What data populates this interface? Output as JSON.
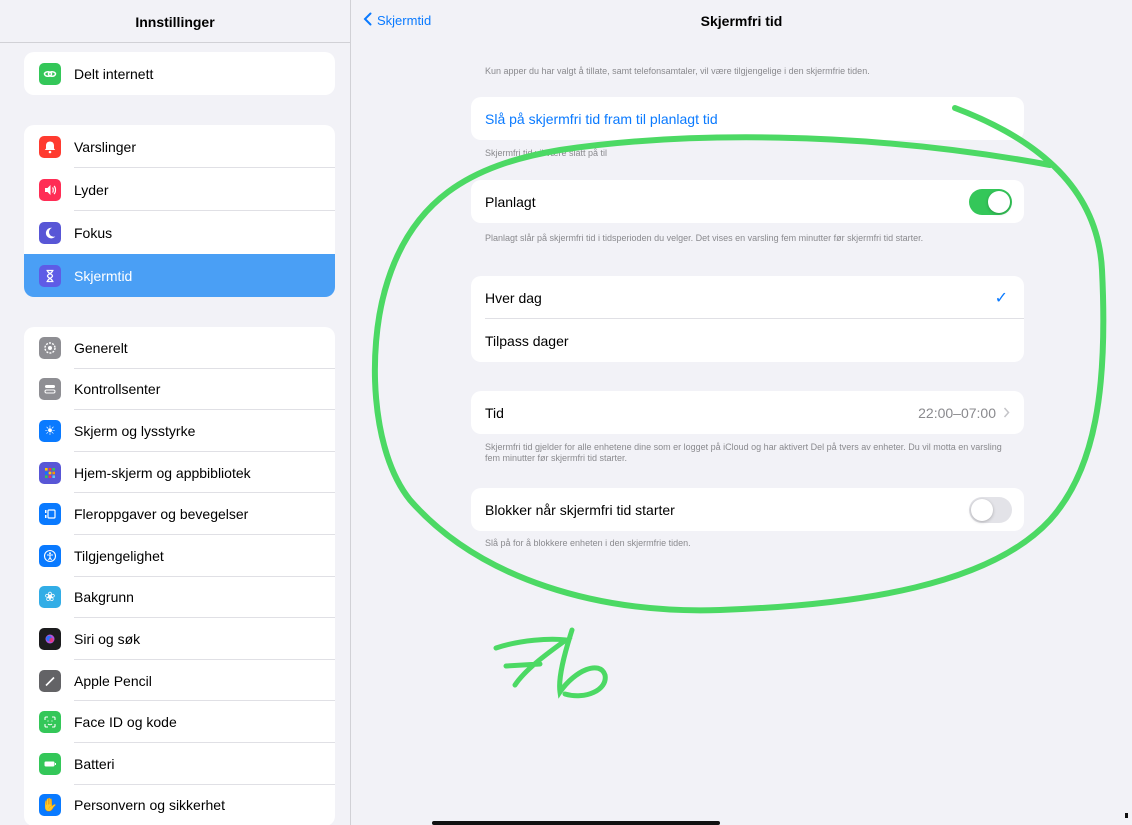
{
  "sidebar": {
    "title": "Innstillinger",
    "group1": [
      {
        "label": "Delt internett",
        "icon": "link-icon",
        "color": "#34c759"
      }
    ],
    "group2": [
      {
        "label": "Varslinger",
        "icon": "bell-icon",
        "color": "#ff3b30"
      },
      {
        "label": "Lyder",
        "icon": "speaker-icon",
        "color": "#ff2d55"
      },
      {
        "label": "Fokus",
        "icon": "moon-icon",
        "color": "#5856d6"
      },
      {
        "label": "Skjermtid",
        "icon": "hourglass-icon",
        "color": "#5e5ce6",
        "selected": true
      }
    ],
    "group3": [
      {
        "label": "Generelt",
        "icon": "gear-icon",
        "color": "#8e8e93"
      },
      {
        "label": "Kontrollsenter",
        "icon": "switches-icon",
        "color": "#8e8e93"
      },
      {
        "label": "Skjerm og lysstyrke",
        "icon": "sun-icon",
        "color": "#0a7aff"
      },
      {
        "label": "Hjem-skjerm og appbibliotek",
        "icon": "grid-icon",
        "color": "#5856d6"
      },
      {
        "label": "Fleroppgaver og bevegelser",
        "icon": "multitask-icon",
        "color": "#0a7aff"
      },
      {
        "label": "Tilgjengelighet",
        "icon": "accessibility-icon",
        "color": "#0a7aff"
      },
      {
        "label": "Bakgrunn",
        "icon": "flower-icon",
        "color": "#32ade6"
      },
      {
        "label": "Siri og søk",
        "icon": "siri-icon",
        "color": "#1c1c1e"
      },
      {
        "label": "Apple Pencil",
        "icon": "pencil-icon",
        "color": "#636366"
      },
      {
        "label": "Face ID og kode",
        "icon": "faceid-icon",
        "color": "#34c759"
      },
      {
        "label": "Batteri",
        "icon": "battery-icon",
        "color": "#34c759"
      },
      {
        "label": "Personvern og sikkerhet",
        "icon": "hand-icon",
        "color": "#0a7aff"
      }
    ]
  },
  "detail": {
    "back_label": "Skjermtid",
    "title": "Skjermfri tid",
    "intro_note": "Kun apper du har valgt å tillate, samt telefonsamtaler, vil være tilgjengelige i den skjermfrie tiden.",
    "turn_on_label": "Slå på skjermfri tid fram til planlagt tid",
    "turn_on_note": "Skjermfri tid vil være slått på til",
    "scheduled_label": "Planlagt",
    "scheduled_on": true,
    "scheduled_note": "Planlagt slår på skjermfri tid i tidsperioden du velger. Det vises en varsling fem minutter før skjermfri tid starter.",
    "days": [
      {
        "label": "Hver dag",
        "checked": true
      },
      {
        "label": "Tilpass dager",
        "checked": false
      }
    ],
    "checkmark": "✓",
    "time_label": "Tid",
    "time_value": "22:00–07:00",
    "time_note": "Skjermfri tid gjelder for alle enhetene dine som er logget på iCloud og har aktivert Del på tvers av enheter. Du vil motta en varsling fem minutter før skjermfri tid starter.",
    "block_label": "Blokker når skjermfri tid starter",
    "block_on": false,
    "block_note": "Slå på for å blokkere enheten i den skjermfrie tiden."
  },
  "annotation": {
    "text": "7b",
    "color": "#4cd964"
  }
}
